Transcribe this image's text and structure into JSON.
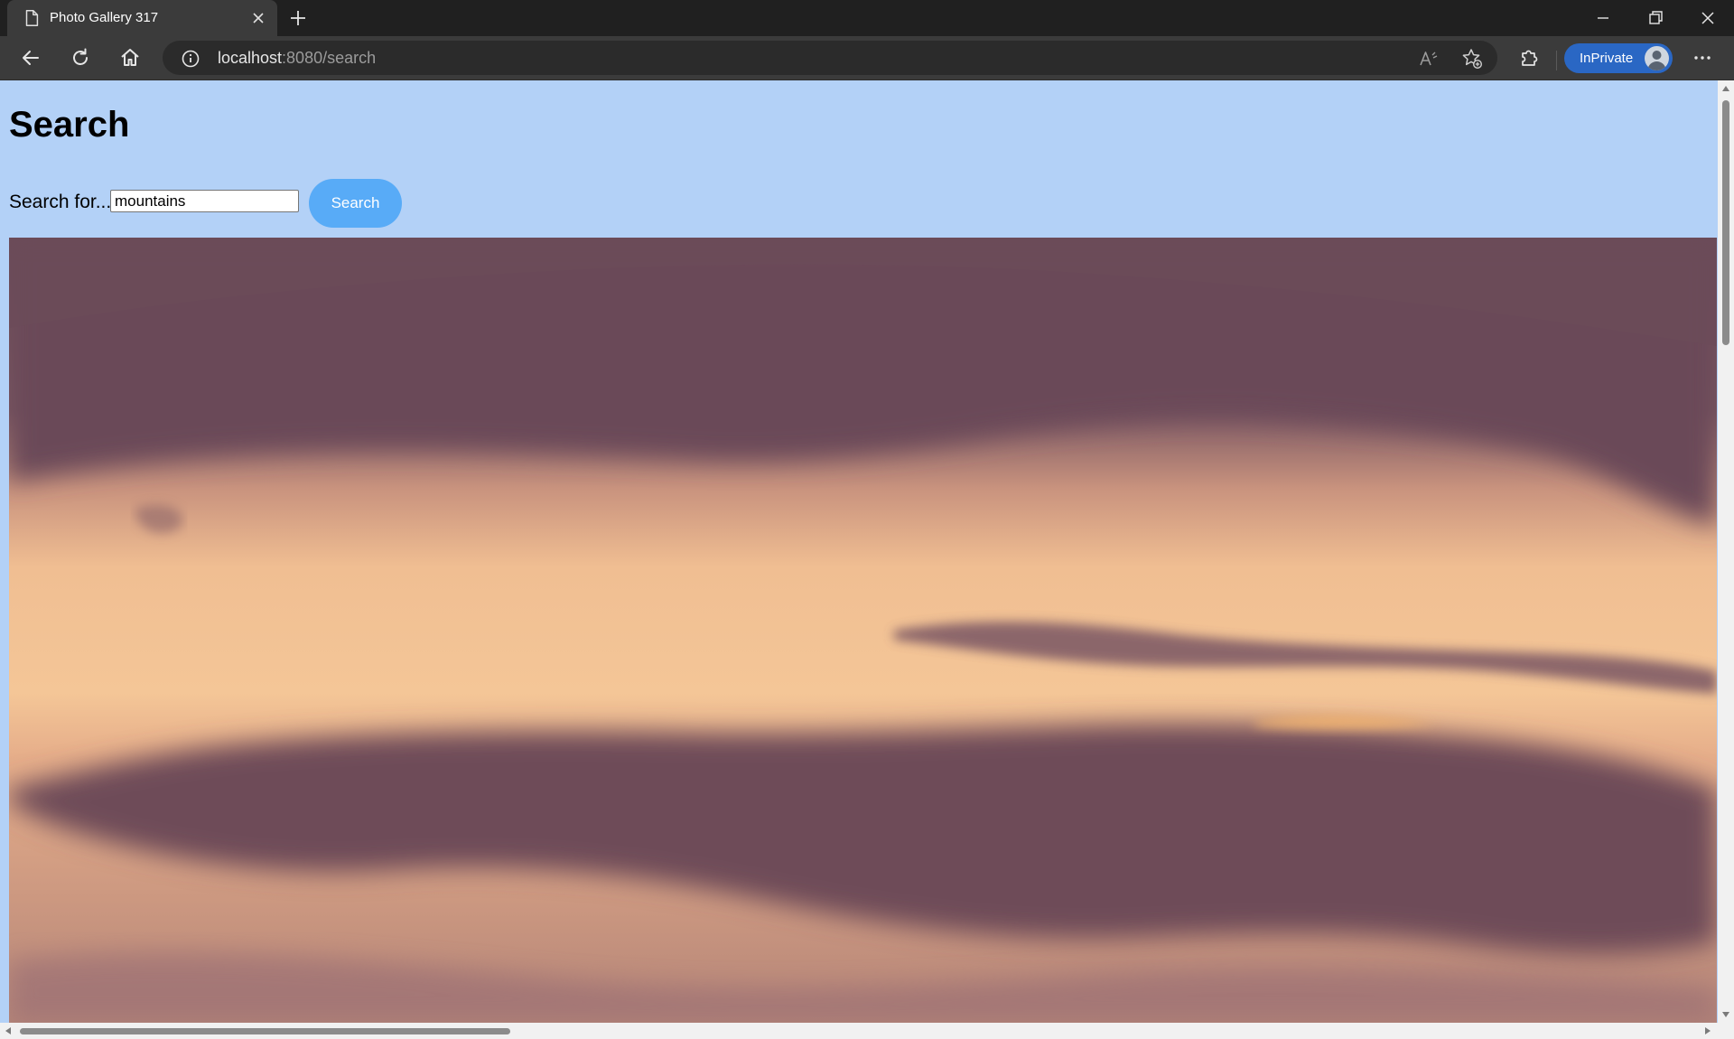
{
  "browser": {
    "tab_title": "Photo Gallery 317",
    "url_host": "localhost",
    "url_path": ":8080/search",
    "inprivate_label": "InPrivate"
  },
  "page": {
    "heading": "Search",
    "search_label": "Search for...",
    "search_value": "mountains",
    "search_button": "Search"
  },
  "colors": {
    "page_background": "#b3d1f7",
    "search_button": "#58abf7",
    "inprivate_badge": "#2a67c4"
  },
  "icons": {
    "tab": "page-icon",
    "back": "arrow-left-icon",
    "refresh": "refresh-icon",
    "home": "home-icon",
    "site_info": "info-icon",
    "read_aloud": "read-aloud-icon",
    "favorites": "star-add-icon",
    "extensions": "puzzle-icon",
    "menu": "more-icon"
  }
}
